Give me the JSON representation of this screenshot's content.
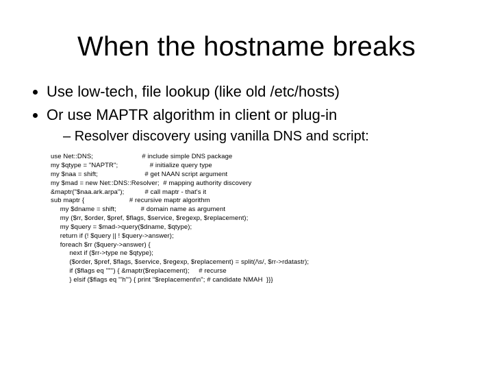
{
  "title": "When the hostname breaks",
  "bullets": [
    "Use low-tech, file lookup (like old /etc/hosts)",
    "Or use MAPTR algorithm in client or plug-in"
  ],
  "subbullet": "Resolver discovery using vanilla DNS and script:",
  "code": "use Net::DNS;                          # include simple DNS package\nmy $qtype = \"NAPTR\";                 # initialize query type\nmy $naa = shift;                         # get NAAN script argument\nmy $mad = new Net::DNS::Resolver;  # mapping authority discovery\n&maptr(\"$naa.ark.arpa\");           # call maptr - that's it\nsub maptr {                        # recursive maptr algorithm\n     my $dname = shift;             # domain name as argument\n     my ($rr, $order, $pref, $flags, $service, $regexp, $replacement);\n     my $query = $mad->query($dname, $qtype);\n     return if (! $query || ! $query->answer);\n     foreach $rr ($query->answer) {\n          next if ($rr->type ne $qtype);\n          ($order, $pref, $flags, $service, $regexp, $replacement) = split(/\\s/, $rr->rdatastr);\n          if ($flags eq '\"\"') { &maptr($replacement);     # recurse\n          } elsif ($flags eq '\"h\"') { print \"$replacement\\n\"; # candidate NMAH  }}}"
}
